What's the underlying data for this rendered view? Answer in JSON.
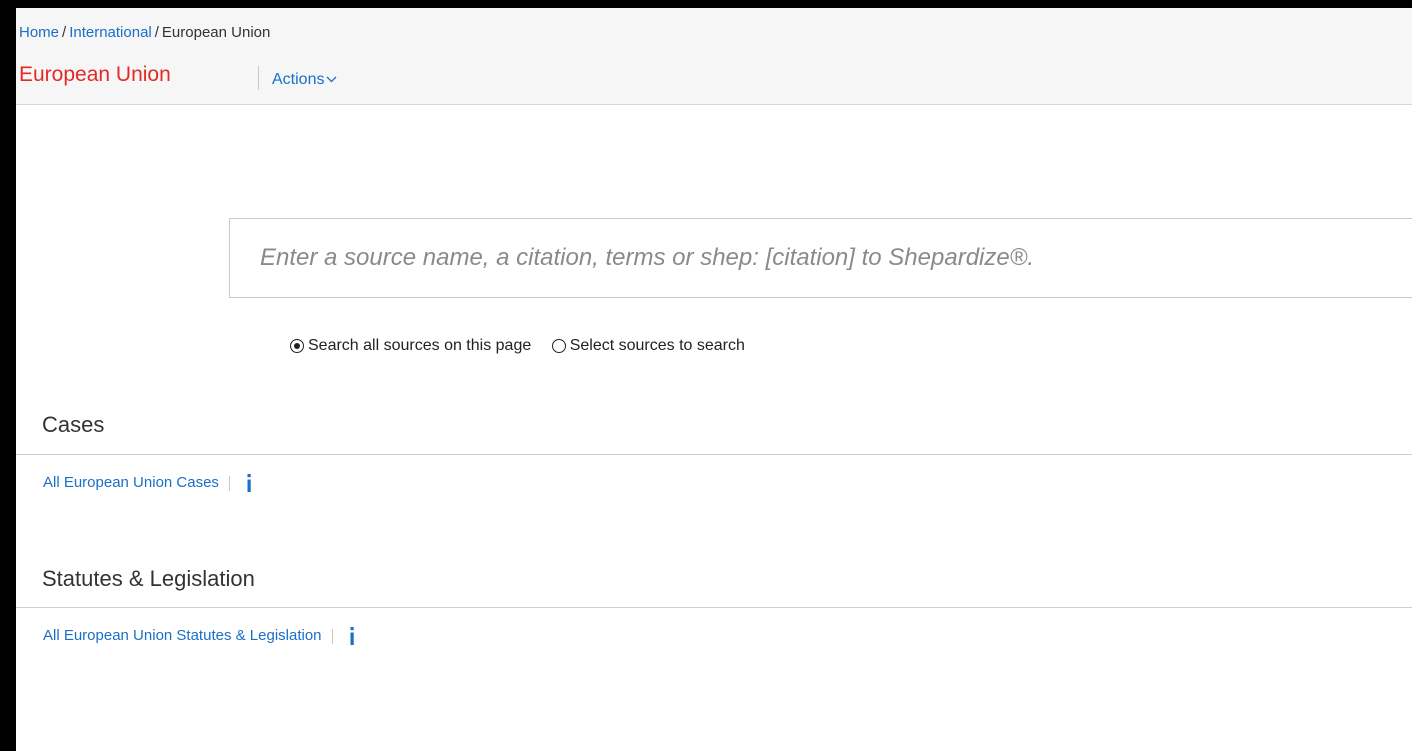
{
  "breadcrumb": {
    "home": "Home",
    "separator": "/",
    "international": "International",
    "current": "European Union"
  },
  "header": {
    "title": "European Union",
    "actions_label": "Actions",
    "actions_icon": "chevron-down-icon"
  },
  "search": {
    "value": "",
    "placeholder": "Enter a source name, a citation, terms or shep: [citation] to Shepardize®."
  },
  "scope_options": [
    {
      "label": "Search all sources on this page",
      "selected": true
    },
    {
      "label": "Select sources to search",
      "selected": false
    }
  ],
  "sections": [
    {
      "heading": "Cases",
      "link": "All European Union Cases",
      "icon": "info-icon"
    },
    {
      "heading": "Statutes & Legislation",
      "link": "All European Union Statutes & Legislation",
      "icon": "info-icon"
    }
  ],
  "colors": {
    "link": "#1a6fc9",
    "title": "#e22b27",
    "heading": "#333333",
    "header_bg": "#f6f6f6"
  }
}
